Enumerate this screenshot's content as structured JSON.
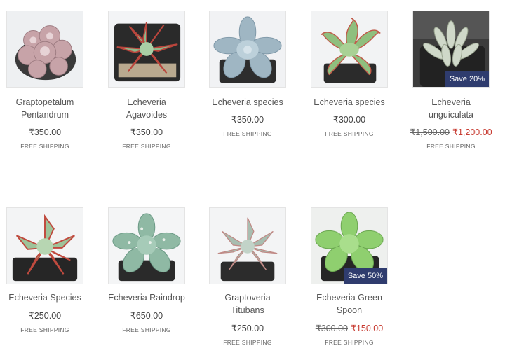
{
  "products": [
    {
      "title_line1": "Graptopetalum",
      "title_line2": "Pentandrum",
      "price": "₹350.00",
      "shipping": "FREE SHIPPING",
      "image": "graptopetalum-pentandrum-photo"
    },
    {
      "title_line1": "Echeveria",
      "title_line2": "Agavoides",
      "price": "₹350.00",
      "shipping": "FREE SHIPPING",
      "image": "echeveria-agavoides-photo"
    },
    {
      "title_line1": "Echeveria species",
      "price": "₹350.00",
      "shipping": "FREE SHIPPING",
      "image": "echeveria-species-blue-photo"
    },
    {
      "title_line1": "Echeveria species",
      "price": "₹300.00",
      "shipping": "FREE SHIPPING",
      "image": "echeveria-species-green-photo"
    },
    {
      "title_line1": "Echeveria",
      "title_line2": "unguiculata",
      "old_price": "₹1,500.00",
      "price": "₹1,200.00",
      "shipping": "FREE SHIPPING",
      "badge": "Save 20%",
      "image": "echeveria-unguiculata-photo"
    },
    {
      "title_line1": "Echeveria Species",
      "price": "₹250.00",
      "shipping": "FREE SHIPPING",
      "image": "echeveria-species-red-edge-photo"
    },
    {
      "title_line1": "Echeveria Raindrop",
      "price": "₹650.00",
      "shipping": "FREE SHIPPING",
      "image": "echeveria-raindrop-photo"
    },
    {
      "title_line1": "Graptoveria",
      "title_line2": "Titubans",
      "price": "₹250.00",
      "shipping": "FREE SHIPPING",
      "image": "graptoveria-titubans-photo"
    },
    {
      "title_line1": "Echeveria Green",
      "title_line2": "Spoon",
      "old_price": "₹300.00",
      "price": "₹150.00",
      "shipping": "FREE SHIPPING",
      "badge": "Save 50%",
      "image": "echeveria-green-spoon-photo"
    }
  ],
  "colors": {
    "badge_bg": "#2f3c6e",
    "sale_price": "#c7392f",
    "text": "#444444"
  }
}
